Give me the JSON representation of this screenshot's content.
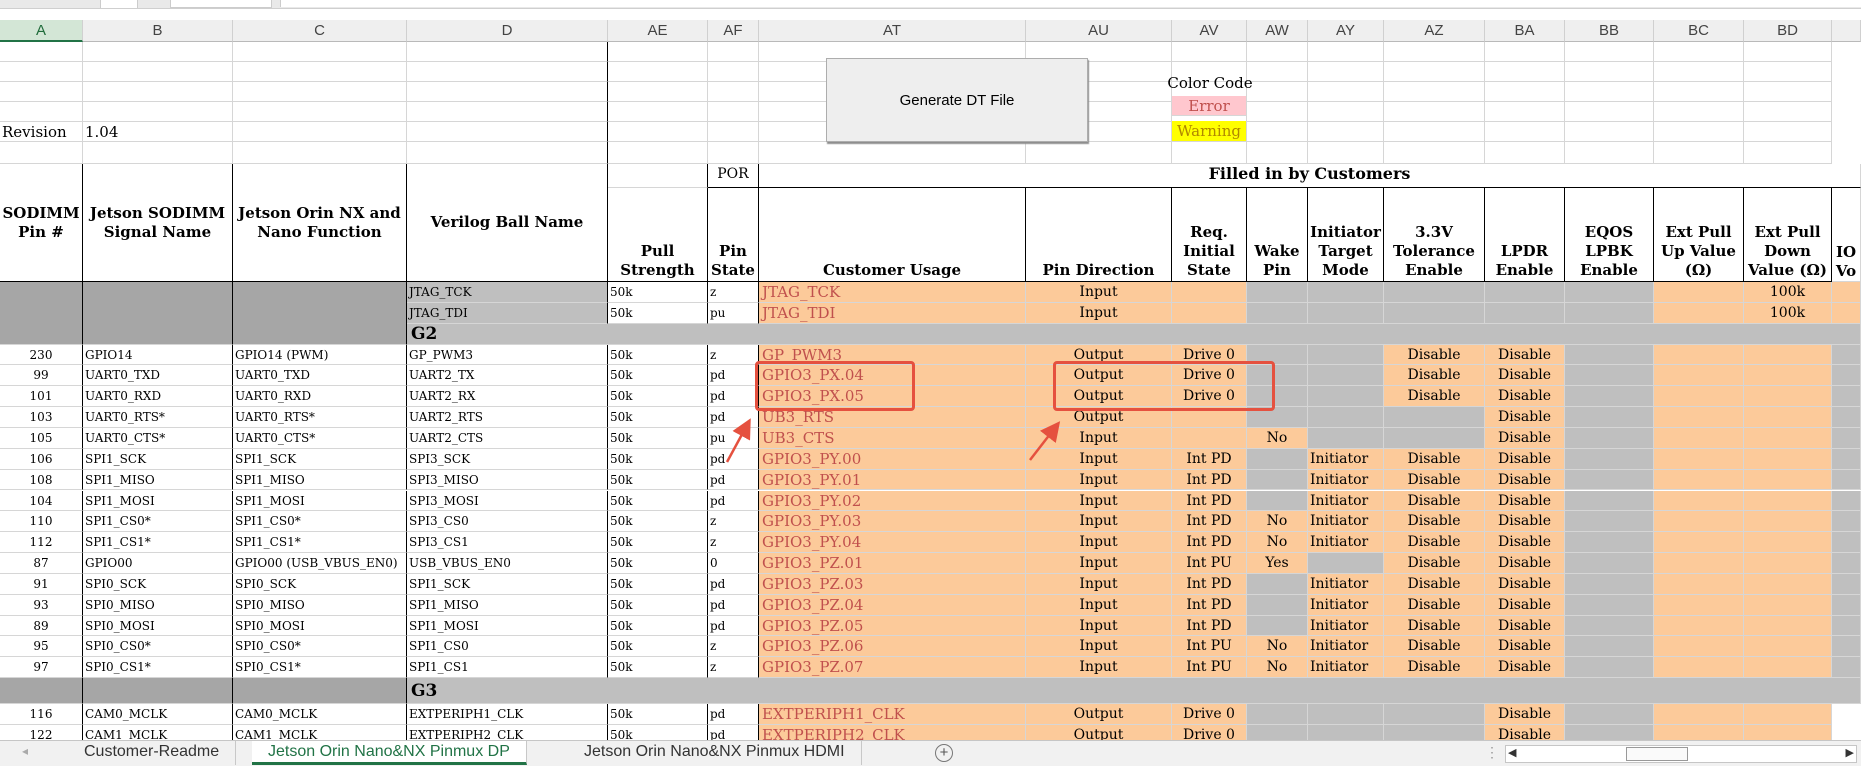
{
  "sheet": {
    "columns": [
      "A",
      "B",
      "C",
      "D",
      "AE",
      "AF",
      "AT",
      "AU",
      "AV",
      "AW",
      "AY",
      "AZ",
      "BA",
      "BB",
      "BC",
      "BD"
    ],
    "selected_column": "A",
    "generate_button": "Generate DT File",
    "color_code": {
      "title": "Color Code",
      "error": "Error",
      "warning": "Warning"
    },
    "revision_label": "Revision",
    "revision_value": "1.04",
    "por_label": "POR",
    "filled_by": "Filled in by Customers",
    "headers": {
      "A": "SODIMM Pin #",
      "B": "Jetson SODIMM Signal Name",
      "C": "Jetson Orin NX and Nano Function",
      "D": "Verilog Ball Name",
      "AE": "Pull Strength",
      "AF": "Pin State",
      "AT": "Customer Usage",
      "AU": "Pin Direction",
      "AV": "Req. Initial State",
      "AW": "Wake Pin",
      "AY": "Initiator Target Mode",
      "AZ": "3.3V Tolerance Enable",
      "BA": "LPDR Enable",
      "BB": "EQOS LPBK Enable",
      "BC": "Ext Pull Up Value (Ω)",
      "BD": "Ext Pull Down Value (Ω)",
      "BE": "IO Vo"
    },
    "jtag_rows": [
      {
        "d": "JTAG_TCK",
        "ae": "50k",
        "af": "z",
        "at": "JTAG_TCK",
        "au": "Input",
        "bd": "100k"
      },
      {
        "d": "JTAG_TDI",
        "ae": "50k",
        "af": "pu",
        "at": "JTAG_TDI",
        "au": "Input",
        "bd": "100k"
      }
    ],
    "group_g2": "G2",
    "rows": [
      {
        "a": "230",
        "b": "GPIO14",
        "c": "GPIO14 (PWM)",
        "d": "GP_PWM3",
        "ae": "50k",
        "af": "z",
        "at": "GP_PWM3",
        "au": "Output",
        "av": "Drive 0",
        "aw": "",
        "ay": "",
        "az": "Disable",
        "ba": "Disable"
      },
      {
        "a": "99",
        "b": "UART0_TXD",
        "c": "UART0_TXD",
        "d": "UART2_TX",
        "ae": "50k",
        "af": "pd",
        "at": "GPIO3_PX.04",
        "au": "Output",
        "av": "Drive 0",
        "aw": "",
        "ay": "",
        "az": "Disable",
        "ba": "Disable"
      },
      {
        "a": "101",
        "b": "UART0_RXD",
        "c": "UART0_RXD",
        "d": "UART2_RX",
        "ae": "50k",
        "af": "pd",
        "at": "GPIO3_PX.05",
        "au": "Output",
        "av": "Drive 0",
        "aw": "",
        "ay": "",
        "az": "Disable",
        "ba": "Disable"
      },
      {
        "a": "103",
        "b": "UART0_RTS*",
        "c": "UART0_RTS*",
        "d": "UART2_RTS",
        "ae": "50k",
        "af": "pd",
        "at": "UB3_RTS",
        "au": "Output",
        "av": "",
        "aw": "",
        "ay": "",
        "az": "",
        "ba": "Disable"
      },
      {
        "a": "105",
        "b": "UART0_CTS*",
        "c": "UART0_CTS*",
        "d": "UART2_CTS",
        "ae": "50k",
        "af": "pu",
        "at": "UB3_CTS",
        "au": "Input",
        "av": "",
        "aw": "No",
        "ay": "",
        "az": "",
        "ba": "Disable"
      },
      {
        "a": "106",
        "b": "SPI1_SCK",
        "c": "SPI1_SCK",
        "d": "SPI3_SCK",
        "ae": "50k",
        "af": "pd",
        "at": "GPIO3_PY.00",
        "au": "Input",
        "av": "Int PD",
        "aw": "",
        "ay": "Initiator",
        "az": "Disable",
        "ba": "Disable"
      },
      {
        "a": "108",
        "b": "SPI1_MISO",
        "c": "SPI1_MISO",
        "d": "SPI3_MISO",
        "ae": "50k",
        "af": "pd",
        "at": "GPIO3_PY.01",
        "au": "Input",
        "av": "Int PD",
        "aw": "",
        "ay": "Initiator",
        "az": "Disable",
        "ba": "Disable"
      },
      {
        "a": "104",
        "b": "SPI1_MOSI",
        "c": "SPI1_MOSI",
        "d": "SPI3_MOSI",
        "ae": "50k",
        "af": "pd",
        "at": "GPIO3_PY.02",
        "au": "Input",
        "av": "Int PD",
        "aw": "",
        "ay": "Initiator",
        "az": "Disable",
        "ba": "Disable"
      },
      {
        "a": "110",
        "b": "SPI1_CS0*",
        "c": "SPI1_CS0*",
        "d": "SPI3_CS0",
        "ae": "50k",
        "af": "z",
        "at": "GPIO3_PY.03",
        "au": "Input",
        "av": "Int PD",
        "aw": "No",
        "ay": "Initiator",
        "az": "Disable",
        "ba": "Disable"
      },
      {
        "a": "112",
        "b": "SPI1_CS1*",
        "c": "SPI1_CS1*",
        "d": "SPI3_CS1",
        "ae": "50k",
        "af": "z",
        "at": "GPIO3_PY.04",
        "au": "Input",
        "av": "Int PD",
        "aw": "No",
        "ay": "Initiator",
        "az": "Disable",
        "ba": "Disable"
      },
      {
        "a": "87",
        "b": "GPIO00",
        "c": "GPIO00 (USB_VBUS_EN0)",
        "d": "USB_VBUS_EN0",
        "ae": "50k",
        "af": "0",
        "at": "GPIO3_PZ.01",
        "au": "Input",
        "av": "Int PU",
        "aw": "Yes",
        "ay": "",
        "az": "Disable",
        "ba": "Disable"
      },
      {
        "a": "91",
        "b": "SPI0_SCK",
        "c": "SPI0_SCK",
        "d": "SPI1_SCK",
        "ae": "50k",
        "af": "pd",
        "at": "GPIO3_PZ.03",
        "au": "Input",
        "av": "Int PD",
        "aw": "",
        "ay": "Initiator",
        "az": "Disable",
        "ba": "Disable"
      },
      {
        "a": "93",
        "b": "SPI0_MISO",
        "c": "SPI0_MISO",
        "d": "SPI1_MISO",
        "ae": "50k",
        "af": "pd",
        "at": "GPIO3_PZ.04",
        "au": "Input",
        "av": "Int PD",
        "aw": "",
        "ay": "Initiator",
        "az": "Disable",
        "ba": "Disable"
      },
      {
        "a": "89",
        "b": "SPI0_MOSI",
        "c": "SPI0_MOSI",
        "d": "SPI1_MOSI",
        "ae": "50k",
        "af": "pd",
        "at": "GPIO3_PZ.05",
        "au": "Input",
        "av": "Int PD",
        "aw": "",
        "ay": "Initiator",
        "az": "Disable",
        "ba": "Disable"
      },
      {
        "a": "95",
        "b": "SPI0_CS0*",
        "c": "SPI0_CS0*",
        "d": "SPI1_CS0",
        "ae": "50k",
        "af": "z",
        "at": "GPIO3_PZ.06",
        "au": "Input",
        "av": "Int PU",
        "aw": "No",
        "ay": "Initiator",
        "az": "Disable",
        "ba": "Disable"
      },
      {
        "a": "97",
        "b": "SPI0_CS1*",
        "c": "SPI0_CS1*",
        "d": "SPI1_CS1",
        "ae": "50k",
        "af": "z",
        "at": "GPIO3_PZ.07",
        "au": "Input",
        "av": "Int PU",
        "aw": "No",
        "ay": "Initiator",
        "az": "Disable",
        "ba": "Disable"
      }
    ],
    "group_g3": "G3",
    "rows_g3": [
      {
        "a": "116",
        "b": "CAM0_MCLK",
        "c": "CAM0_MCLK",
        "d": "EXTPERIPH1_CLK",
        "ae": "50k",
        "af": "pd",
        "at": "EXTPERIPH1_CLK",
        "au": "Output",
        "av": "Drive 0",
        "ba": "Disable"
      },
      {
        "a": "122",
        "b": "CAM1_MCLK",
        "c": "CAM1_MCLK",
        "d": "EXTPERIPH2_CLK",
        "ae": "50k",
        "af": "pd",
        "at": "EXTPERIPH2_CLK",
        "au": "Output",
        "av": "Drive 0",
        "ba": "Disable"
      }
    ]
  },
  "tabs": [
    "Customer-Readme",
    "Jetson Orin Nano&NX Pinmux DP",
    "Jetson Orin Nano&NX Pinmux HDMI"
  ],
  "active_tab": "Jetson Orin Nano&NX Pinmux DP",
  "colors": {
    "orange": "#fcca9a",
    "grey": "#bfbfbf",
    "error": "#ffc7ce",
    "warning": "#ffff00",
    "annotation": "#e5513f",
    "accent": "#217346"
  }
}
